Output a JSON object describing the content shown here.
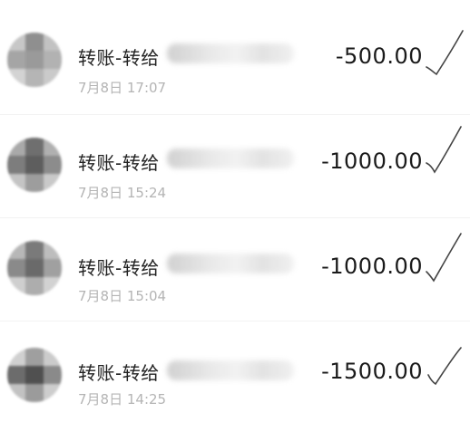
{
  "transactions": [
    {
      "title": "转账-转给",
      "time": "7月8日 17:07",
      "amount": "-500.00",
      "check_icon": "check-icon"
    },
    {
      "title": "转账-转给",
      "time": "7月8日 15:24",
      "amount": "-1000.00",
      "check_icon": "check-icon"
    },
    {
      "title": "转账-转给",
      "time": "7月8日 15:04",
      "amount": "-1000.00",
      "check_icon": "check-icon"
    },
    {
      "title": "转账-转给",
      "time": "7月8日 14:25",
      "amount": "-1500.00",
      "check_icon": "check-icon"
    }
  ],
  "colors": {
    "text_primary": "#222222",
    "text_secondary": "#b4b4b4",
    "check_stroke": "#444444"
  }
}
